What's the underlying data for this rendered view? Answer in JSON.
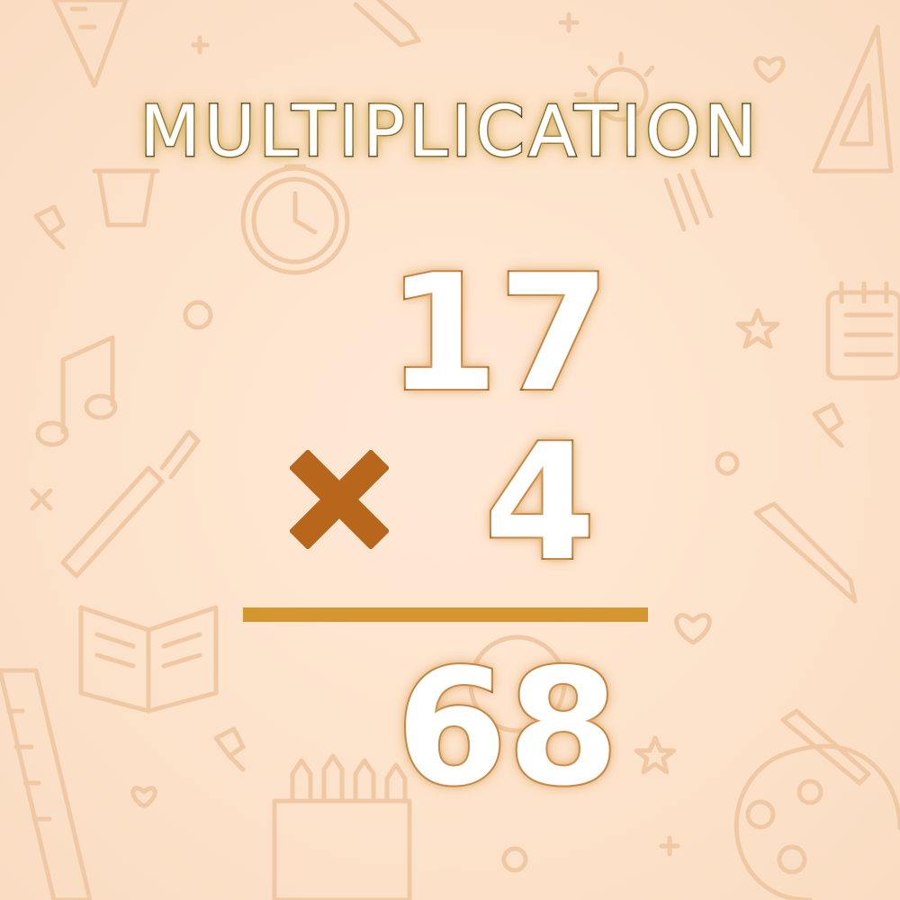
{
  "title": "MULTIPLICATION",
  "problem": {
    "multiplicand": "17",
    "operator": "×",
    "multiplier": "4",
    "product": "68"
  },
  "colors": {
    "background": "#fde3cb",
    "doodle_stroke": "#f0c9a4",
    "operator": "#b8661c",
    "rule": "#d6962f",
    "number_outline": "#9a5a1c",
    "title_outline": "#3a2a10"
  },
  "decorations": [
    "triangle-ruler-icon",
    "pencil-icon",
    "light-bulb-icon",
    "heart-icon",
    "cup-icon",
    "clock-icon",
    "push-pin-icon",
    "notepad-icon",
    "star-icon",
    "music-note-icon",
    "paint-brush-icon",
    "open-book-icon",
    "ruler-icon",
    "crayon-box-icon",
    "paint-palette-icon"
  ]
}
